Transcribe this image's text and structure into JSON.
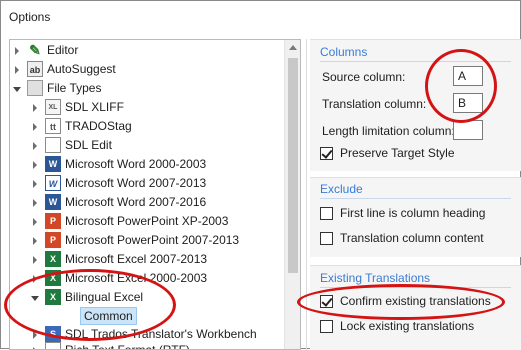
{
  "window": {
    "title": "Options"
  },
  "tree": {
    "items": [
      {
        "label": "Editor",
        "icon": "editor-icon"
      },
      {
        "label": "AutoSuggest",
        "icon": "autosuggest-icon"
      },
      {
        "label": "File Types",
        "icon": "folder-icon"
      },
      {
        "label": "SDL XLIFF",
        "icon": "xliff-icon"
      },
      {
        "label": "TRADOStag",
        "icon": "tradostag-icon"
      },
      {
        "label": "SDL Edit",
        "icon": "document-icon"
      },
      {
        "label": "Microsoft Word 2000-2003",
        "icon": "word-icon"
      },
      {
        "label": "Microsoft Word 2007-2013",
        "icon": "word-icon"
      },
      {
        "label": "Microsoft Word 2007-2016",
        "icon": "word-icon"
      },
      {
        "label": "Microsoft PowerPoint XP-2003",
        "icon": "powerpoint-icon"
      },
      {
        "label": "Microsoft PowerPoint 2007-2013",
        "icon": "powerpoint-icon"
      },
      {
        "label": "Microsoft Excel 2007-2013",
        "icon": "excel-icon"
      },
      {
        "label": "Microsoft Excel 2000-2003",
        "icon": "excel-icon"
      },
      {
        "label": "Bilingual Excel",
        "icon": "excel-icon"
      },
      {
        "label": "Common",
        "icon": ""
      },
      {
        "label": "SDL Trados Translator's Workbench",
        "icon": "sdl-icon"
      },
      {
        "label": "Rich Text Format (RTF)",
        "icon": "rtf-icon"
      }
    ]
  },
  "columns": {
    "heading": "Columns",
    "source_label": "Source column:",
    "source_value": "A",
    "translation_label": "Translation column:",
    "translation_value": "B",
    "length_label": "Length limitation column:",
    "length_value": "",
    "preserve_label": "Preserve Target Style",
    "preserve_checked": true
  },
  "exclude": {
    "heading": "Exclude",
    "first_line_label": "First line is column heading",
    "translation_content_label": "Translation column content"
  },
  "existing": {
    "heading": "Existing Translations",
    "confirm_label": "Confirm existing translations",
    "lock_label": "Lock existing translations"
  },
  "colors": {
    "heading_blue": "#3a7bd5",
    "annotation_red": "#d41414",
    "selection": "#cce4f7"
  }
}
